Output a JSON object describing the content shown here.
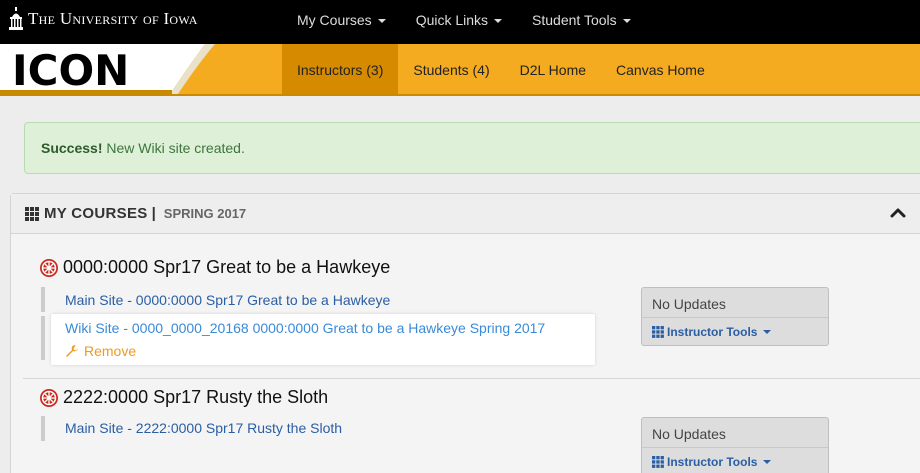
{
  "topbar": {
    "brand": "The University of Iowa",
    "nav": [
      {
        "label": "My Courses"
      },
      {
        "label": "Quick Links"
      },
      {
        "label": "Student Tools"
      }
    ]
  },
  "goldbar": {
    "logo": "ICON",
    "nav": [
      {
        "label": "Instructors (3)",
        "active": true
      },
      {
        "label": "Students (4)"
      },
      {
        "label": "D2L Home"
      },
      {
        "label": "Canvas Home"
      }
    ]
  },
  "alert": {
    "strong": "Success!",
    "message": "New Wiki site created."
  },
  "panel": {
    "title": "MY COURSES",
    "separator": "|",
    "term": "SPRING 2017"
  },
  "courses": [
    {
      "title": "0000:0000 Spr17 Great to be a Hawkeye",
      "main_link": "Main Site - 0000:0000 Spr17 Great to be a Hawkeye",
      "wiki_link": "Wiki Site - 0000_0000_20168 0000:0000 Great to be a Hawkeye Spring 2017",
      "remove_label": "Remove",
      "updates": "No Updates",
      "tools_label": "Instructor Tools"
    },
    {
      "title": "2222:0000 Spr17 Rusty the Sloth",
      "main_link": "Main Site - 2222:0000 Spr17 Rusty the Sloth",
      "updates": "No Updates",
      "tools_label": "Instructor Tools"
    }
  ],
  "colors": {
    "gold": "#f4ab1f",
    "gold_active": "#d58a00",
    "link": "#2a5ea4",
    "success_bg": "#dff0d8",
    "remove": "#ef9a23"
  }
}
